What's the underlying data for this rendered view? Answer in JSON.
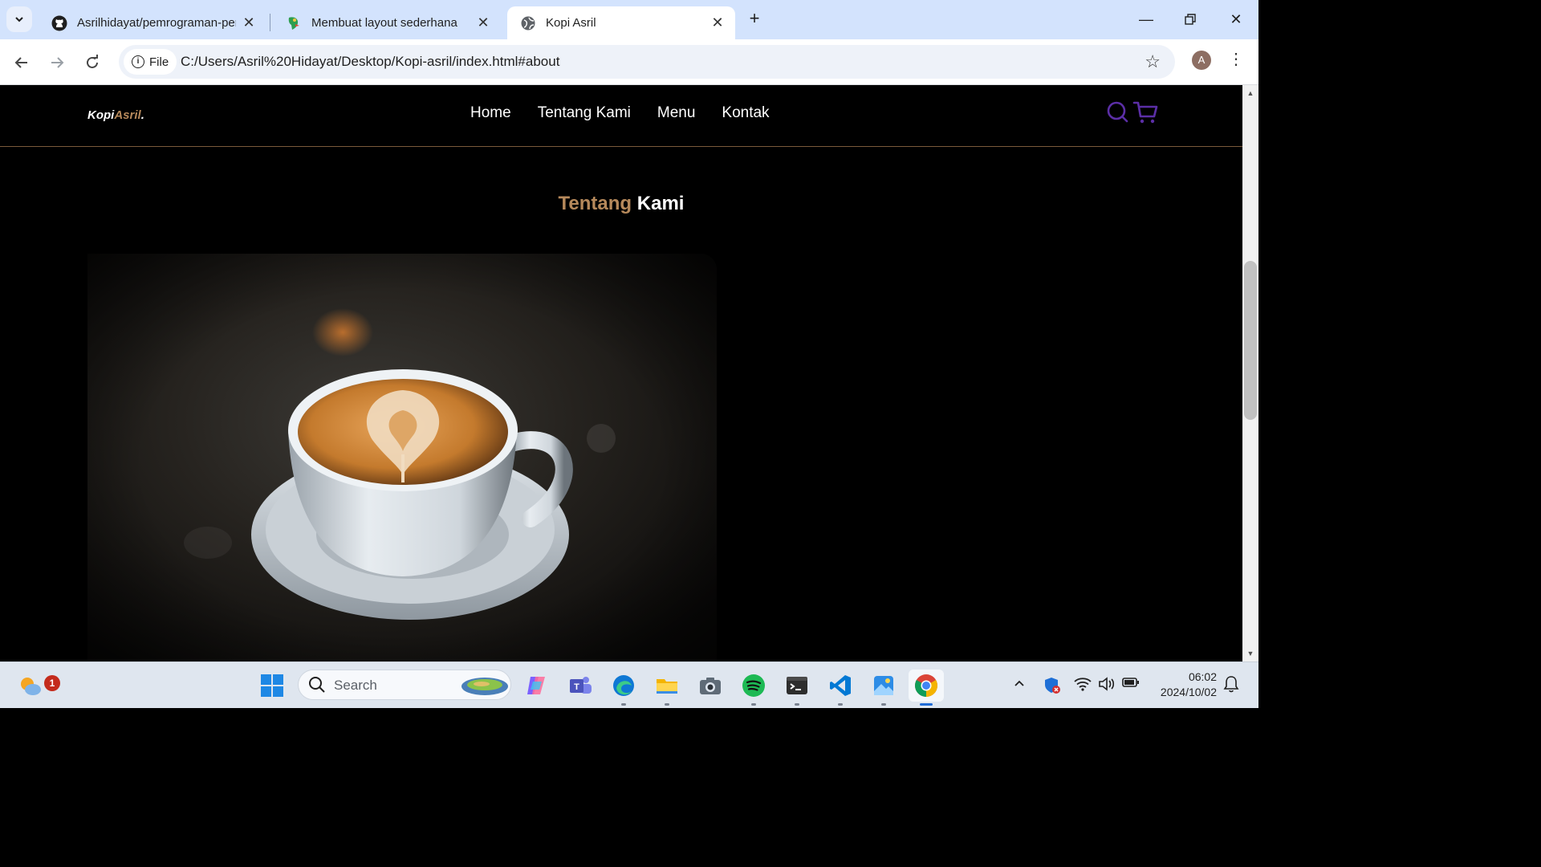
{
  "browser": {
    "tabs": [
      {
        "title": "Asrilhidayat/pemrograman-per",
        "favicon": "github-icon"
      },
      {
        "title": "Membuat layout sederhana",
        "favicon": "parrot-icon"
      },
      {
        "title": "Kopi Asril",
        "favicon": "globe-icon",
        "active": true
      }
    ],
    "address": {
      "chip_label": "File",
      "url": "C:/Users/Asril%20Hidayat/Desktop/Kopi-asril/index.html#about"
    },
    "profile_initial": "A"
  },
  "site": {
    "logo": {
      "part1": "Kopi",
      "part2": "Asril",
      "suffix": "."
    },
    "nav": [
      "Home",
      "Tentang Kami",
      "Menu",
      "Kontak"
    ],
    "icons": [
      "search-icon",
      "cart-icon"
    ],
    "accent_color": "#b6895b",
    "icon_color": "#5b2ea6",
    "section": {
      "title_part1": "Tentang",
      "title_part2": "Kami"
    }
  },
  "taskbar": {
    "search_label": "Search",
    "weather_badge": "1",
    "clock": {
      "time": "06:02",
      "date": "2024/10/02"
    }
  }
}
